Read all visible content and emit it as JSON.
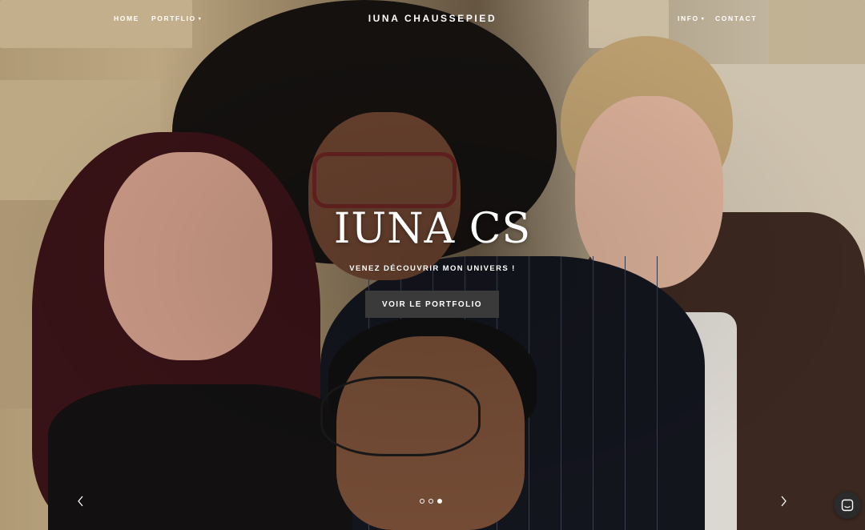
{
  "header": {
    "nav_left": [
      {
        "label": "HOME",
        "has_dropdown": false
      },
      {
        "label": "PORTFLIO",
        "has_dropdown": true
      }
    ],
    "site_title": "IUNA CHAUSSEPIED",
    "nav_right": [
      {
        "label": "INFO",
        "has_dropdown": true
      },
      {
        "label": "CONTACT",
        "has_dropdown": false
      }
    ]
  },
  "hero": {
    "heading": "IUNA CS",
    "subheading": "VENEZ DÉCOUVRIR MON UNIVERS !",
    "cta_label": "VOIR LE PORTFOLIO"
  },
  "slider": {
    "slide_count": 3,
    "active_slide": 3,
    "prev_icon": "chevron-left-icon",
    "next_icon": "chevron-right-icon"
  },
  "chat": {
    "icon": "chat-bubble-icon"
  },
  "colors": {
    "text": "#ffffff",
    "button_bg": "#3a3a3a",
    "chat_bg": "#2b2b2b"
  }
}
